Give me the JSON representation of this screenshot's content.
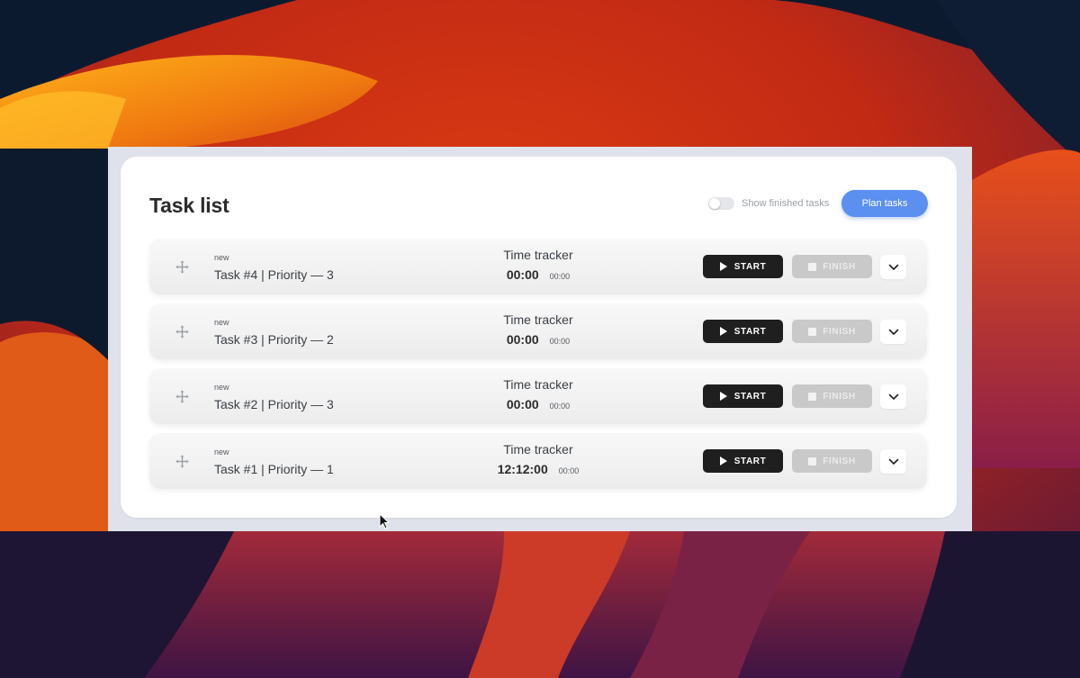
{
  "header": {
    "title": "Task list",
    "show_finished_label": "Show finished tasks",
    "show_finished_enabled": false,
    "plan_button_label": "Plan tasks"
  },
  "tasks": [
    {
      "status": "new",
      "name": "Task #4 | Priority — 3",
      "tracker_label": "Time tracker",
      "tracker_main": "00:00",
      "tracker_sub": "00:00",
      "start_label": "START",
      "finish_label": "FINISH"
    },
    {
      "status": "new",
      "name": "Task #3 | Priority — 2",
      "tracker_label": "Time tracker",
      "tracker_main": "00:00",
      "tracker_sub": "00:00",
      "start_label": "START",
      "finish_label": "FINISH"
    },
    {
      "status": "new",
      "name": "Task #2 | Priority — 3",
      "tracker_label": "Time tracker",
      "tracker_main": "00:00",
      "tracker_sub": "00:00",
      "start_label": "START",
      "finish_label": "FINISH"
    },
    {
      "status": "new",
      "name": "Task #1 | Priority — 1",
      "tracker_label": "Time tracker",
      "tracker_main": "12:12:00",
      "tracker_sub": "00:00",
      "start_label": "START",
      "finish_label": "FINISH"
    }
  ],
  "icons": {
    "drag": "move-arrows-icon",
    "start": "play-icon",
    "finish": "stop-icon",
    "expand": "chevron-down-icon"
  },
  "colors": {
    "accent": "#5b8ff0",
    "start_button": "#1f1f1f",
    "finish_button_disabled": "#c9c9c9"
  }
}
